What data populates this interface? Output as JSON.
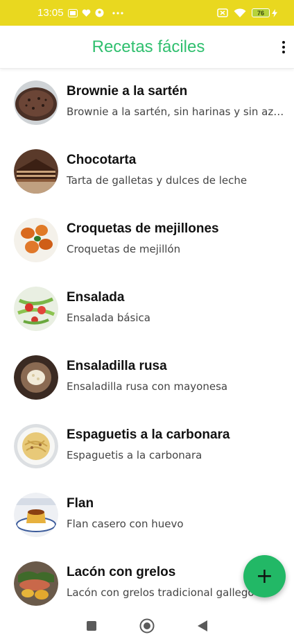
{
  "status_bar": {
    "time": "13:05",
    "icons_left": [
      "media-icon",
      "heart-icon",
      "location-icon",
      "more-dots-icon"
    ],
    "icons_right": [
      "sim-off-icon",
      "wifi-icon",
      "battery-icon",
      "charging-icon"
    ],
    "battery_level": "76"
  },
  "app_bar": {
    "title": "Recetas fáciles",
    "menu_icon": "overflow-menu-icon"
  },
  "recipes": [
    {
      "title": "Brownie a la sartén",
      "subtitle": "Brownie a la sartén, sin harinas y sin azúcar",
      "thumb": "brownie"
    },
    {
      "title": "Chocotarta",
      "subtitle": "Tarta de galletas y dulces de leche",
      "thumb": "chocotarta"
    },
    {
      "title": "Croquetas de mejillones",
      "subtitle": "Croquetas de mejillón",
      "thumb": "croquetas"
    },
    {
      "title": "Ensalada",
      "subtitle": "Ensalada básica",
      "thumb": "ensalada"
    },
    {
      "title": "Ensaladilla rusa",
      "subtitle": "Ensaladilla rusa con mayonesa",
      "thumb": "ensaladilla"
    },
    {
      "title": "Espaguetis a la carbonara",
      "subtitle": "Espaguetis a la carbonara",
      "thumb": "espaguetis"
    },
    {
      "title": "Flan",
      "subtitle": "Flan casero con huevo",
      "thumb": "flan"
    },
    {
      "title": "Lacón con grelos",
      "subtitle": "Lacón con grelos tradicional gallego",
      "thumb": "lacon"
    }
  ],
  "fab": {
    "label": "+",
    "icon": "add-icon"
  },
  "colors": {
    "status_bar": "#e9d81f",
    "accent": "#2fbf6e",
    "fab": "#22b866"
  },
  "nav_bar": {
    "icons": [
      "recents-icon",
      "home-icon",
      "back-icon"
    ]
  }
}
